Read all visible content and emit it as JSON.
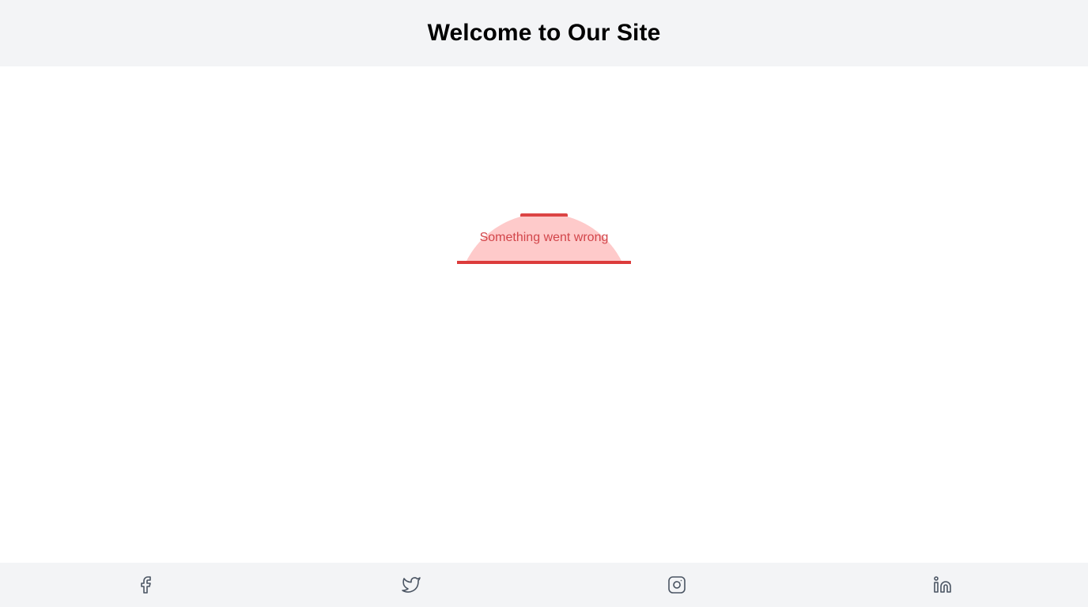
{
  "header": {
    "title": "Welcome to Our Site"
  },
  "main": {
    "error_message": "Something went wrong"
  },
  "footer": {
    "social_links": [
      {
        "icon": "facebook-icon"
      },
      {
        "icon": "twitter-icon"
      },
      {
        "icon": "instagram-icon"
      },
      {
        "icon": "linkedin-icon"
      }
    ]
  },
  "colors": {
    "header_bg": "#f3f4f6",
    "error_bg": "#fecaca",
    "error_accent": "#dc3b3b",
    "error_text": "#d2454a",
    "icon": "#4b5563"
  }
}
